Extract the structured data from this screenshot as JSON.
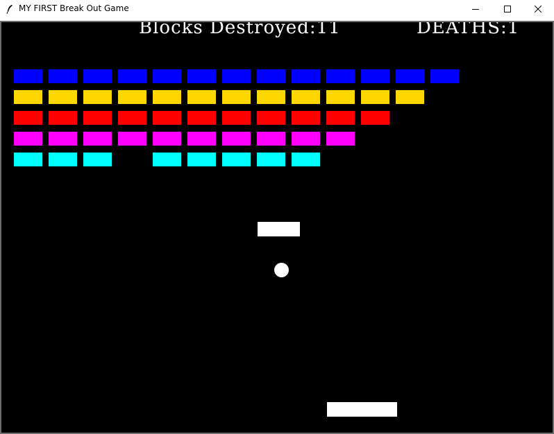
{
  "window": {
    "title": "MY FIRST Break Out Game",
    "icons": {
      "app": "feather-icon",
      "minimize": "minimize-icon",
      "maximize": "maximize-icon",
      "close": "close-icon"
    }
  },
  "hud": {
    "blocks_text": "Blocks Destroyed:11",
    "deaths_text": "DEATHS:1",
    "blocks_destroyed": 11,
    "deaths": 1
  },
  "colors": {
    "background": "#000000",
    "blue": "#0000ff",
    "yellow": "#ffd700",
    "red": "#ff0000",
    "magenta": "#ff00ff",
    "cyan": "#00ffff",
    "paddle": "#ffffff",
    "ball": "#ffffff",
    "text": "#ffffff"
  },
  "bricks": {
    "rows": [
      {
        "color": "blue",
        "present": [
          1,
          1,
          1,
          1,
          1,
          1,
          1,
          1,
          1,
          1,
          1,
          1,
          1
        ]
      },
      {
        "color": "yellow",
        "present": [
          1,
          1,
          1,
          1,
          1,
          1,
          1,
          1,
          1,
          1,
          1,
          1,
          0
        ]
      },
      {
        "color": "red",
        "present": [
          1,
          1,
          1,
          1,
          1,
          1,
          1,
          1,
          1,
          1,
          1,
          0,
          0
        ]
      },
      {
        "color": "magenta",
        "present": [
          1,
          1,
          1,
          1,
          1,
          1,
          1,
          1,
          1,
          1,
          0,
          0,
          0
        ]
      },
      {
        "color": "cyan",
        "present": [
          1,
          1,
          1,
          0,
          1,
          1,
          1,
          1,
          1,
          0,
          0,
          0,
          0
        ]
      }
    ]
  }
}
